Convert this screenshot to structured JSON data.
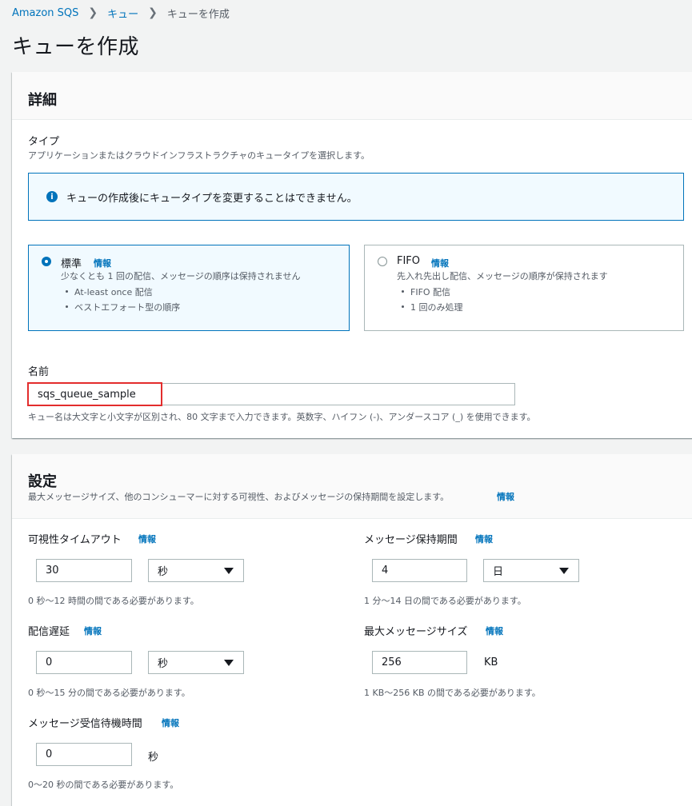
{
  "breadcrumb": {
    "root": "Amazon SQS",
    "level2": "キュー",
    "current": "キューを作成"
  },
  "page_title": "キューを作成",
  "details": {
    "title": "詳細",
    "type_label": "タイプ",
    "type_desc": "アプリケーションまたはクラウドインフラストラクチャのキュータイプを選択します。",
    "alert": "キューの作成後にキュータイプを変更することはできません。",
    "standard": {
      "title": "標準",
      "info": "情報",
      "desc": "少なくとも 1 回の配信、メッセージの順序は保持されません",
      "bullets": [
        "At-least once 配信",
        "ベストエフォート型の順序"
      ],
      "selected": true
    },
    "fifo": {
      "title": "FIFO",
      "info": "情報",
      "desc": "先入れ先出し配信、メッセージの順序が保持されます",
      "bullets": [
        "FIFO 配信",
        "1 回のみ処理"
      ],
      "selected": false
    },
    "name_label": "名前",
    "name_value": "sqs_queue_sample",
    "name_help": "キュー名は大文字と小文字が区別され、80 文字まで入力できます。英数字、ハイフン (-)、アンダースコア (_) を使用できます。"
  },
  "settings": {
    "title": "設定",
    "desc": "最大メッセージサイズ、他のコンシューマーに対する可視性、およびメッセージの保持期間を設定します。",
    "info": "情報",
    "visibility": {
      "label": "可視性タイムアウト",
      "info": "情報",
      "value": "30",
      "unit": "秒",
      "help": "0 秒〜12 時間の間である必要があります。"
    },
    "retention": {
      "label": "メッセージ保持期間",
      "info": "情報",
      "value": "4",
      "unit": "日",
      "help": "1 分〜14 日の間である必要があります。"
    },
    "delay": {
      "label": "配信遅延",
      "info": "情報",
      "value": "0",
      "unit": "秒",
      "help": "0 秒〜15 分の間である必要があります。"
    },
    "max_size": {
      "label": "最大メッセージサイズ",
      "info": "情報",
      "value": "256",
      "unit": "KB",
      "help": "1 KB〜256 KB の間である必要があります。"
    },
    "receive_wait": {
      "label": "メッセージ受信待機時間",
      "info": "情報",
      "value": "0",
      "unit": "秒",
      "help": "0〜20 秒の間である必要があります。"
    }
  },
  "colors": {
    "link": "#0073bb",
    "highlight": "#e32d2d",
    "selected_bg": "#f1faff"
  }
}
